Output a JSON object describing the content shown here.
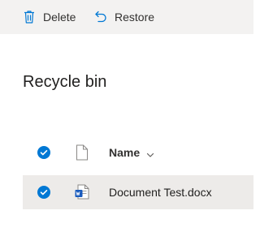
{
  "toolbar": {
    "delete_label": "Delete",
    "restore_label": "Restore"
  },
  "page": {
    "title": "Recycle bin"
  },
  "list": {
    "columns": [
      {
        "label": "Name"
      }
    ],
    "rows": [
      {
        "name": "Document Test.docx",
        "icon": "word-document-icon",
        "selected": true
      }
    ]
  },
  "colors": {
    "accent": "#0078d4",
    "toolbar_bg": "#f3f2f1",
    "selected_row_bg": "#edebe9",
    "word_blue": "#185abd"
  }
}
